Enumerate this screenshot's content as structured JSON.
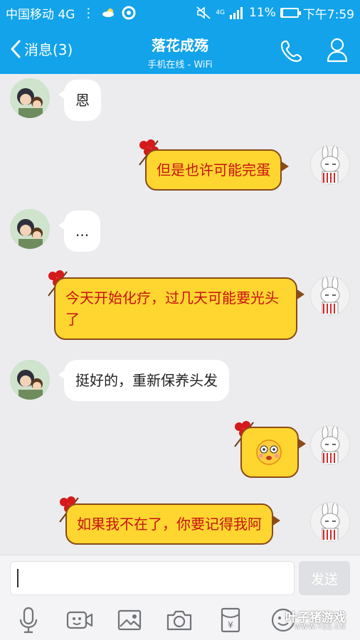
{
  "status_bar": {
    "carrier": "中国移动 4G",
    "network": "4G",
    "battery": "11%",
    "battery_level": 0.11,
    "time": "下午7:59"
  },
  "header": {
    "back_label": "消息(3)",
    "title": "落花成殇",
    "subtitle": "手机在线 - WiFi"
  },
  "messages": [
    {
      "side": "left",
      "text": "恩"
    },
    {
      "side": "right",
      "text": "但是也许可能完蛋"
    },
    {
      "side": "left",
      "text": "..."
    },
    {
      "side": "right",
      "text": "今天开始化疗，过几天可能要光头了"
    },
    {
      "side": "left",
      "text": "挺好的，重新保养头发"
    },
    {
      "side": "right",
      "text": "",
      "emoji": "surprised-face"
    },
    {
      "side": "right",
      "text": "如果我不在了，你要记得我阿"
    }
  ],
  "input": {
    "value": "",
    "send_label": "发送"
  },
  "toolbar": {
    "items": [
      "microphone-icon",
      "video-icon",
      "image-icon",
      "camera-icon",
      "red-packet-icon",
      "emoji-icon"
    ]
  },
  "watermark": {
    "main": "叶子猪游戏",
    "sub": "WWW.YZZ.CN"
  },
  "colors": {
    "header": "#12a3ea",
    "bubble_right": "#ffd530",
    "bubble_right_text": "#c7130f",
    "bubble_left": "#ffffff"
  }
}
